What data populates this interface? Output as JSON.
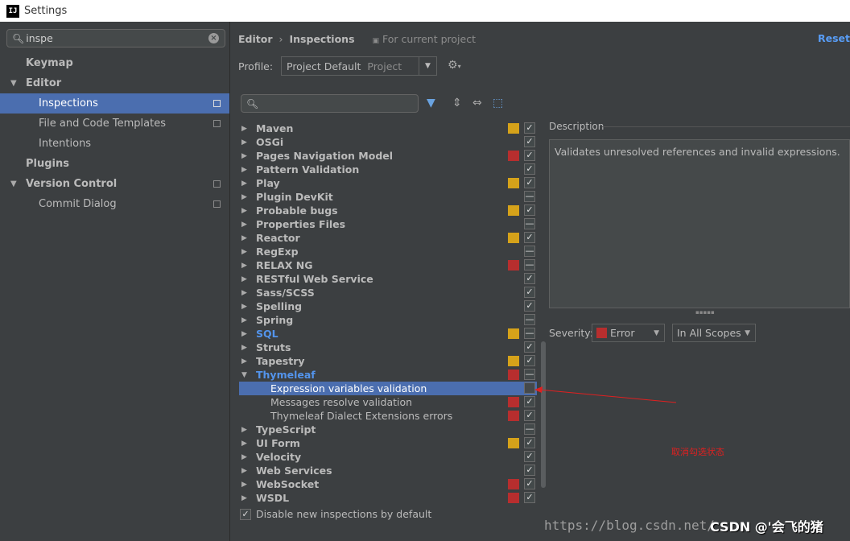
{
  "window": {
    "title": "Settings",
    "logo": "IJ"
  },
  "sidebar": {
    "search_value": "inspe",
    "items": [
      {
        "label": "Keymap"
      },
      {
        "label": "Editor"
      },
      {
        "label": "Inspections"
      },
      {
        "label": "File and Code Templates"
      },
      {
        "label": "Intentions"
      },
      {
        "label": "Plugins"
      },
      {
        "label": "Version Control"
      },
      {
        "label": "Commit Dialog"
      }
    ]
  },
  "header": {
    "crumb1": "Editor",
    "crumb2": "Inspections",
    "scope": "For current project",
    "reset": "Reset"
  },
  "profile": {
    "label": "Profile:",
    "value": "Project Default",
    "sub": "Project"
  },
  "inspections": [
    {
      "name": "Maven",
      "sev": "yellow",
      "check": "checked"
    },
    {
      "name": "OSGi",
      "sev": "",
      "check": "checked"
    },
    {
      "name": "Pages Navigation Model",
      "sev": "red",
      "check": "checked"
    },
    {
      "name": "Pattern Validation",
      "sev": "",
      "check": "checked"
    },
    {
      "name": "Play",
      "sev": "yellow",
      "check": "checked"
    },
    {
      "name": "Plugin DevKit",
      "sev": "",
      "check": "mixed"
    },
    {
      "name": "Probable bugs",
      "sev": "yellow",
      "check": "checked"
    },
    {
      "name": "Properties Files",
      "sev": "",
      "check": "mixed"
    },
    {
      "name": "Reactor",
      "sev": "yellow",
      "check": "checked"
    },
    {
      "name": "RegExp",
      "sev": "",
      "check": "mixed"
    },
    {
      "name": "RELAX NG",
      "sev": "red",
      "check": "mixed"
    },
    {
      "name": "RESTful Web Service",
      "sev": "",
      "check": "checked"
    },
    {
      "name": "Sass/SCSS",
      "sev": "",
      "check": "checked"
    },
    {
      "name": "Spelling",
      "sev": "",
      "check": "checked"
    },
    {
      "name": "Spring",
      "sev": "",
      "check": "mixed"
    },
    {
      "name": "SQL",
      "sev": "yellow",
      "check": "mixed"
    },
    {
      "name": "Struts",
      "sev": "",
      "check": "checked"
    },
    {
      "name": "Tapestry",
      "sev": "yellow",
      "check": "checked"
    },
    {
      "name": "Thymeleaf",
      "sev": "red",
      "check": "mixed"
    },
    {
      "name": "Expression variables validation",
      "sev": "",
      "check": "empty"
    },
    {
      "name": "Messages resolve validation",
      "sev": "red",
      "check": "checked"
    },
    {
      "name": "Thymeleaf Dialect Extensions errors",
      "sev": "red",
      "check": "checked"
    },
    {
      "name": "TypeScript",
      "sev": "",
      "check": "mixed"
    },
    {
      "name": "UI Form",
      "sev": "yellow",
      "check": "checked"
    },
    {
      "name": "Velocity",
      "sev": "",
      "check": "checked"
    },
    {
      "name": "Web Services",
      "sev": "",
      "check": "checked"
    },
    {
      "name": "WebSocket",
      "sev": "red",
      "check": "checked"
    },
    {
      "name": "WSDL",
      "sev": "red",
      "check": "checked"
    }
  ],
  "disable_label": "Disable new inspections by default",
  "description": {
    "title": "Description",
    "text": "Validates unresolved references and invalid expressions."
  },
  "severity": {
    "label": "Severity:",
    "value": "Error",
    "scope": "In All Scopes"
  },
  "annotation": {
    "text": "取消勾选状态"
  },
  "watermark": {
    "url": "https://blog.csdn.net/",
    "csdn": "CSDN @'会飞的猪"
  },
  "colors": {
    "accent": "#4b6eaf",
    "link": "#589df6",
    "sev_red": "#b72e2e",
    "sev_yellow": "#d5a21a"
  }
}
